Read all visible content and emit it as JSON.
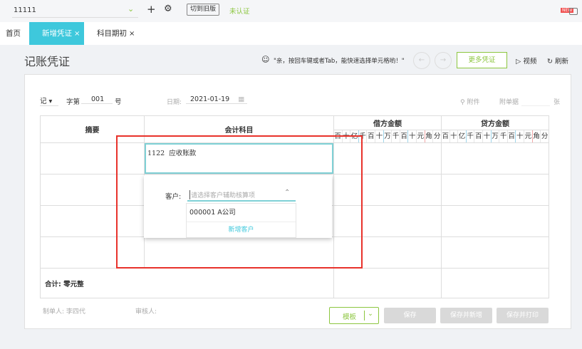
{
  "topbar": {
    "account": "11111",
    "switch_old": "切到旧版",
    "auth_status": "未认证",
    "new_badge": "NEW"
  },
  "tabs": [
    {
      "label": "首页"
    },
    {
      "label": "新增凭证"
    },
    {
      "label": "科目期初"
    }
  ],
  "page": {
    "title": "记账凭证",
    "tip": "\"亲，按回车键或者Tab，能快速选择单元格哟！\"",
    "more_vouchers": "更多凭证",
    "video": "视频",
    "refresh": "刷新"
  },
  "form": {
    "voucher_type": "记",
    "word_no_label": "字第",
    "number": "001",
    "number_suffix": "号",
    "date_label": "日期:",
    "date": "2021-01-19",
    "attachment": "附件",
    "attach_count_label": "附单据",
    "attach_unit": "张"
  },
  "table": {
    "summary_header": "摘要",
    "subject_header": "会计科目",
    "debit_header": "借方金额",
    "credit_header": "贷方金额",
    "units": [
      "百",
      "十",
      "亿",
      "千",
      "百",
      "十",
      "万",
      "千",
      "百",
      "十",
      "元",
      "角",
      "分"
    ],
    "row1_subject": "1122  应收账款",
    "total_label": "合计:",
    "total_value": "零元整"
  },
  "dropdown": {
    "label": "客户:",
    "placeholder": "请选择客户辅助核算项",
    "option": "000001 A公司",
    "add": "新增客户"
  },
  "footer": {
    "maker": "制单人: 李四代",
    "reviewer": "审核人:",
    "template": "模板",
    "save": "保存",
    "save_new": "保存并新增",
    "save_print": "保存并打印"
  },
  "colors": {
    "accent": "#3ec8dc",
    "green": "#8cc63f",
    "highlight": "#e8322b"
  }
}
